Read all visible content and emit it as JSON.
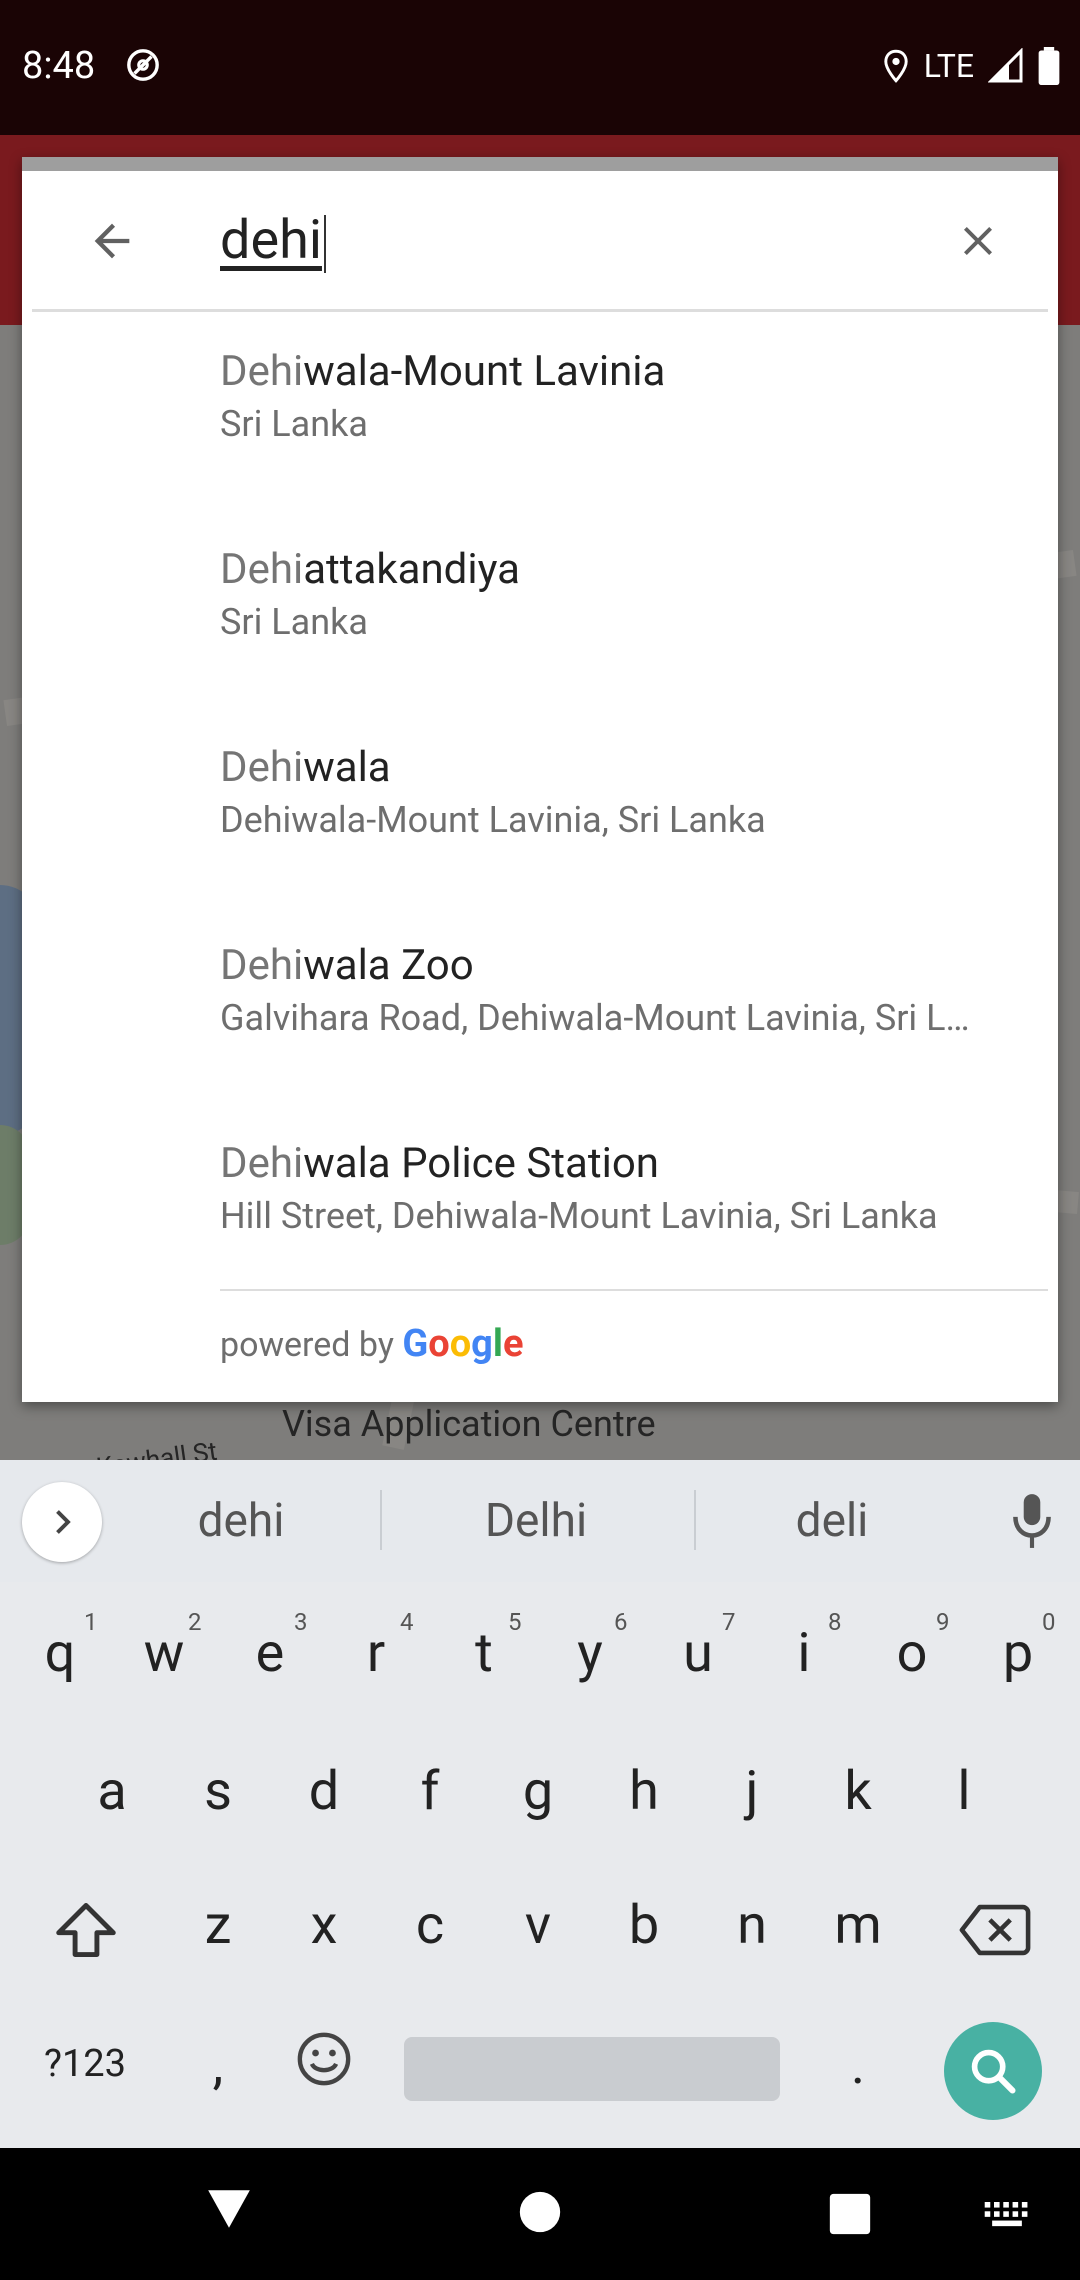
{
  "status_bar": {
    "time": "8:48",
    "network": "LTE"
  },
  "map": {
    "labels": [
      "Visa Application Centre",
      "Kawhall St"
    ]
  },
  "search": {
    "query": "dehi"
  },
  "results": [
    {
      "match": "Dehi",
      "rest": "wala-Mount Lavinia",
      "secondary": "Sri Lanka"
    },
    {
      "match": "Dehi",
      "rest": "attakandiya",
      "secondary": "Sri Lanka"
    },
    {
      "match": "Dehi",
      "rest": "wala",
      "secondary": "Dehiwala-Mount Lavinia, Sri Lanka"
    },
    {
      "match": "Dehi",
      "rest": "wala Zoo",
      "secondary": "Galvihara Road, Dehiwala-Mount Lavinia, Sri L…"
    },
    {
      "match": "Dehi",
      "rest": "wala Police Station",
      "secondary": "Hill Street, Dehiwala-Mount Lavinia, Sri Lanka"
    }
  ],
  "attribution": {
    "prefix": "powered by",
    "brand_letters": [
      "G",
      "o",
      "o",
      "g",
      "l",
      "e"
    ]
  },
  "keyboard": {
    "suggestions": [
      "dehi",
      "Delhi",
      "deli"
    ],
    "row1": [
      "q",
      "w",
      "e",
      "r",
      "t",
      "y",
      "u",
      "i",
      "o",
      "p"
    ],
    "row1_hints": [
      "1",
      "2",
      "3",
      "4",
      "5",
      "6",
      "7",
      "8",
      "9",
      "0"
    ],
    "row2": [
      "a",
      "s",
      "d",
      "f",
      "g",
      "h",
      "j",
      "k",
      "l"
    ],
    "row3": [
      "z",
      "x",
      "c",
      "v",
      "b",
      "n",
      "m"
    ],
    "symbols_key": "?123",
    "comma": ",",
    "period": "."
  },
  "colors": {
    "accent": "#48b1a3",
    "appbar": "#7a1a1e"
  }
}
